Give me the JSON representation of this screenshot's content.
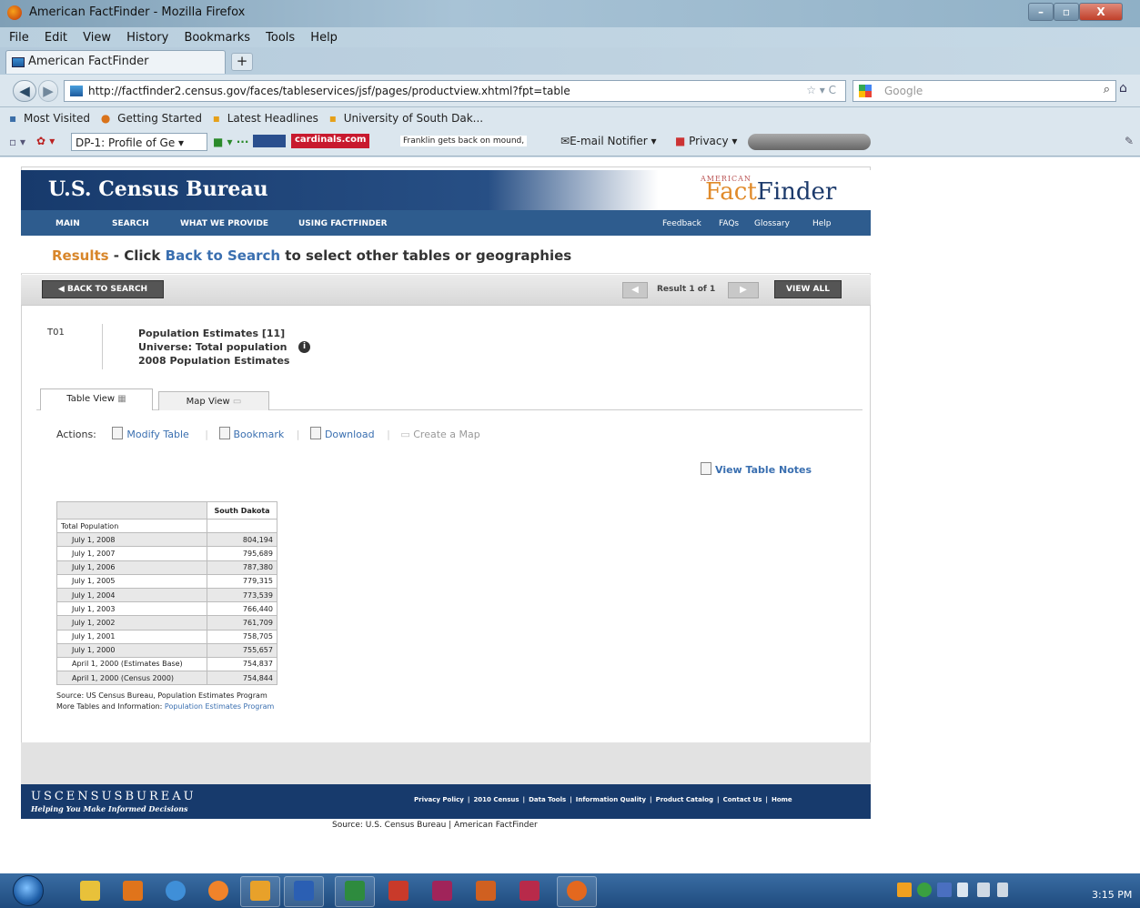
{
  "window": {
    "title": "American FactFinder - Mozilla Firefox",
    "controls": [
      "–",
      "▫",
      "X"
    ]
  },
  "menubar": [
    "File",
    "Edit",
    "View",
    "History",
    "Bookmarks",
    "Tools",
    "Help"
  ],
  "tab": {
    "label": "American FactFinder",
    "new_tab": "+"
  },
  "address": {
    "url": "http://factfinder2.census.gov/faces/tableservices/jsf/pages/productview.xhtml?fpt=table",
    "search_placeholder": "Google"
  },
  "bookmarks": [
    "Most Visited",
    "Getting Started",
    "Latest Headlines",
    "University of South Dak..."
  ],
  "toolbar2": {
    "dropdown": "DP-1: Profile of Ge",
    "badge": "cardinals.com",
    "ticker": "Franklin gets back on mound,",
    "email_notifier": "E-mail Notifier",
    "privacy": "Privacy"
  },
  "site": {
    "logo": "U.S. Census Bureau",
    "ff_small": "AMERICAN",
    "ff_fact": "Fact",
    "ff_finder": "Finder",
    "nav_left": [
      "MAIN",
      "SEARCH",
      "WHAT WE PROVIDE",
      "USING FACTFINDER"
    ],
    "nav_right": [
      "Feedback",
      "FAQs",
      "Glossary",
      "Help"
    ],
    "results": {
      "word": "Results",
      "dash": " - Click ",
      "link": "Back to Search",
      "rest": " to select other tables or geographies"
    },
    "back_button": "◀ BACK TO SEARCH",
    "result_count": "Result 1 of 1",
    "view_all": "VIEW ALL",
    "table_id": "T01",
    "table_title": "Population Estimates [11]",
    "universe": "Universe: Total population",
    "vintage": "2008 Population Estimates",
    "info_icon": "i",
    "tabs": {
      "table_view": "Table View",
      "map_view": "Map View"
    },
    "actions": {
      "label": "Actions:",
      "modify": "Modify Table",
      "bookmark": "Bookmark",
      "download": "Download",
      "create_map": "Create a Map"
    },
    "view_notes": "View Table Notes"
  },
  "table": {
    "column_header": "South Dakota",
    "group_label": "Total Population",
    "rows": [
      {
        "label": "July 1, 2008",
        "value": "804,194"
      },
      {
        "label": "July 1, 2007",
        "value": "795,689"
      },
      {
        "label": "July 1, 2006",
        "value": "787,380"
      },
      {
        "label": "July 1, 2005",
        "value": "779,315"
      },
      {
        "label": "July 1, 2004",
        "value": "773,539"
      },
      {
        "label": "July 1, 2003",
        "value": "766,440"
      },
      {
        "label": "July 1, 2002",
        "value": "761,709"
      },
      {
        "label": "July 1, 2001",
        "value": "758,705"
      },
      {
        "label": "July 1, 2000",
        "value": "755,657"
      },
      {
        "label": "April 1, 2000 (Estimates Base)",
        "value": "754,837"
      },
      {
        "label": "April 1, 2000 (Census 2000)",
        "value": "754,844"
      }
    ],
    "source": "Source: US Census Bureau, Population Estimates Program",
    "more_label": "More Tables and Information:",
    "more_link": "Population Estimates Program"
  },
  "footer": {
    "logo": "USCENSUSBUREAU",
    "tagline": "Helping You Make Informed Decisions",
    "links": [
      "Privacy Policy",
      "2010 Census",
      "Data Tools",
      "Information Quality",
      "Product Catalog",
      "Contact Us",
      "Home"
    ],
    "page_source": "Source: U.S. Census Bureau  |  American FactFinder"
  },
  "taskbar": {
    "clock": "3:15 PM"
  },
  "colors": {
    "census_blue": "#173a6c",
    "nav_blue": "#2e5c8e",
    "results_orange": "#d8862a",
    "link_blue": "#3a6fb0"
  }
}
